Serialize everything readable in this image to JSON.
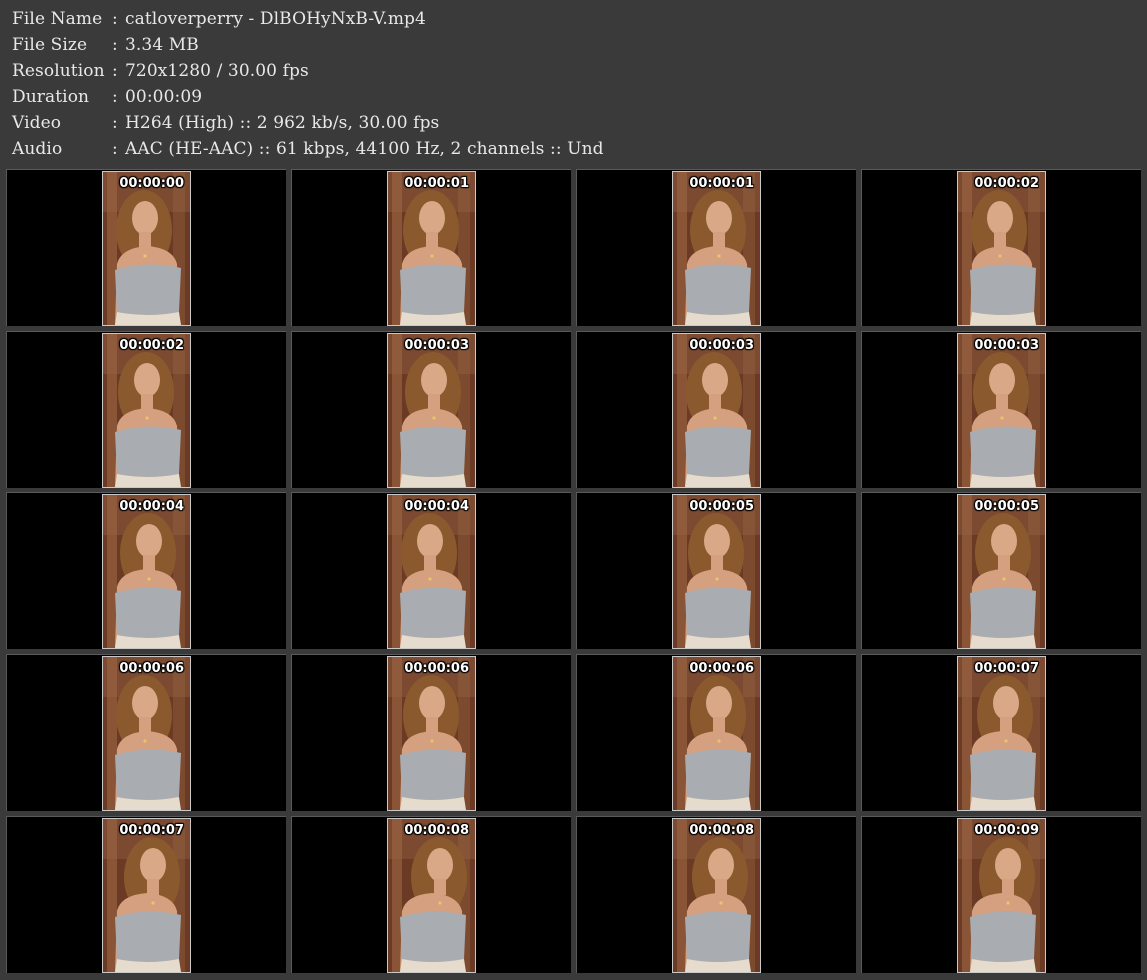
{
  "info": [
    {
      "label": "File Name",
      "sep": ":",
      "value": "catloverperry - DlBOHyNxB-V.mp4"
    },
    {
      "label": "File Size",
      "sep": ":",
      "value": "3.34 MB"
    },
    {
      "label": "Resolution",
      "sep": ":",
      "value": "720x1280 / 30.00 fps"
    },
    {
      "label": "Duration",
      "sep": ":",
      "value": "00:00:09"
    },
    {
      "label": "Video",
      "sep": ":",
      "value": "H264 (High) :: 2 962 kb/s, 30.00 fps"
    },
    {
      "label": "Audio",
      "sep": ":",
      "value": "AAC (HE-AAC) :: 61 kbps, 44100 Hz, 2 channels :: Und"
    }
  ],
  "thumbnails": [
    {
      "timestamp": "00:00:00"
    },
    {
      "timestamp": "00:00:01"
    },
    {
      "timestamp": "00:00:01"
    },
    {
      "timestamp": "00:00:02"
    },
    {
      "timestamp": "00:00:02"
    },
    {
      "timestamp": "00:00:03"
    },
    {
      "timestamp": "00:00:03"
    },
    {
      "timestamp": "00:00:03"
    },
    {
      "timestamp": "00:00:04"
    },
    {
      "timestamp": "00:00:04"
    },
    {
      "timestamp": "00:00:05"
    },
    {
      "timestamp": "00:00:05"
    },
    {
      "timestamp": "00:00:06"
    },
    {
      "timestamp": "00:00:06"
    },
    {
      "timestamp": "00:00:06"
    },
    {
      "timestamp": "00:00:07"
    },
    {
      "timestamp": "00:00:07"
    },
    {
      "timestamp": "00:00:08"
    },
    {
      "timestamp": "00:00:08"
    },
    {
      "timestamp": "00:00:09"
    }
  ],
  "colors": {
    "background": "#3a3a3a",
    "cell": "#000000",
    "text": "#e8e8e8",
    "frame_wall": "#6b3a24",
    "top": "#a9acb0"
  }
}
